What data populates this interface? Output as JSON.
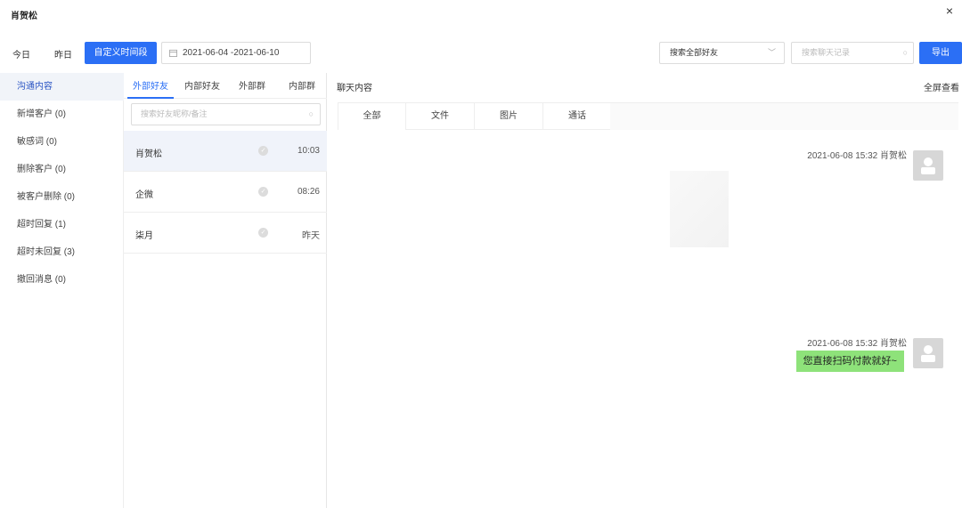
{
  "header": {
    "title": "肖贺松",
    "close": "×"
  },
  "toolbar": {
    "today": "今日",
    "yesterday": "昨日",
    "custom": "自定义时间段",
    "date_range": "2021-06-04  -2021-06-10",
    "friend_select": "搜索全部好友",
    "search_placeholder": "搜索聊天记录",
    "export": "导出"
  },
  "categories": [
    {
      "label": "沟通内容"
    },
    {
      "label": "新增客户 (0)"
    },
    {
      "label": "敏感词 (0)"
    },
    {
      "label": "删除客户 (0)"
    },
    {
      "label": "被客户删除 (0)"
    },
    {
      "label": "超时回复 (1)"
    },
    {
      "label": "超时未回复 (3)"
    },
    {
      "label": "撤回消息 (0)"
    }
  ],
  "friend_tabs": [
    {
      "label": "外部好友"
    },
    {
      "label": "内部好友"
    },
    {
      "label": "外部群"
    },
    {
      "label": "内部群"
    }
  ],
  "friend_search_placeholder": "搜索好友昵称/备注",
  "friends": [
    {
      "name": "肖贺松",
      "time": "10:03"
    },
    {
      "name": "企微",
      "time": "08:26"
    },
    {
      "name": "柒月",
      "time": "昨天"
    }
  ],
  "chat": {
    "title": "聊天内容",
    "fullscreen": "全屏查看",
    "tabs": [
      {
        "label": "全部"
      },
      {
        "label": "文件"
      },
      {
        "label": "图片"
      },
      {
        "label": "通话"
      }
    ],
    "messages": [
      {
        "meta": "2021-06-08 15:32   肖贺松",
        "text": ""
      },
      {
        "meta": "2021-06-08 15:32   肖贺松",
        "text": "您直接扫码付款就好~"
      }
    ]
  }
}
